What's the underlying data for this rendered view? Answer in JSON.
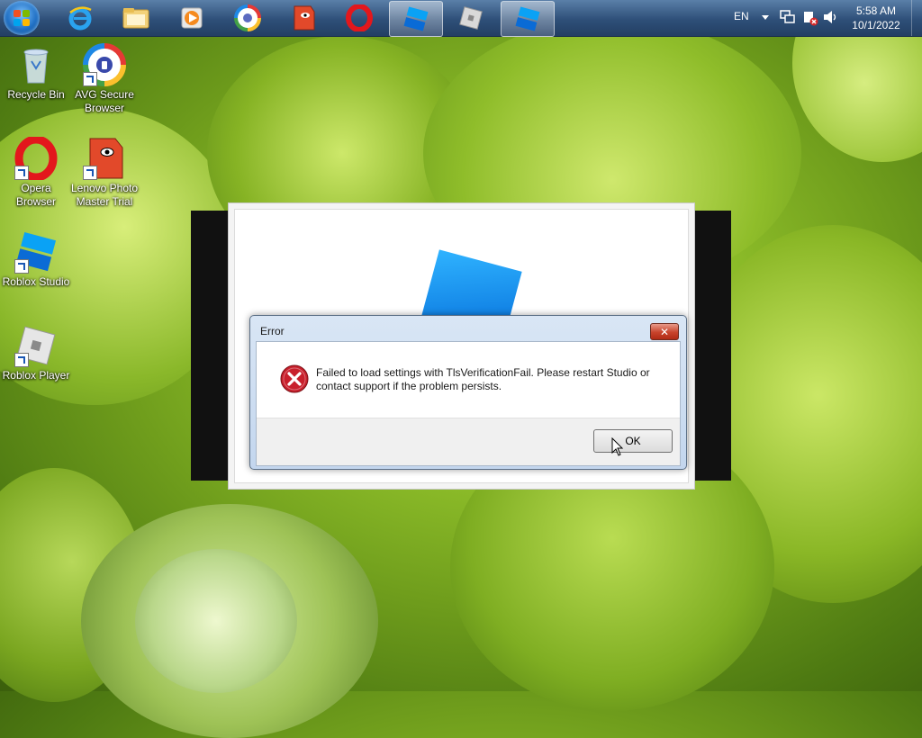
{
  "desktop": {
    "icons": [
      {
        "label": "Recycle Bin"
      },
      {
        "label": "AVG Secure Browser"
      },
      {
        "label": "Opera Browser"
      },
      {
        "label": "Lenovo Photo Master Trial"
      },
      {
        "label": "Roblox Studio"
      },
      {
        "label": "Roblox Player"
      }
    ]
  },
  "taskbar": {
    "language": "EN",
    "time": "5:58 AM",
    "date": "10/1/2022"
  },
  "dialog": {
    "title": "Error",
    "close_label": "✕",
    "message": "Failed to load settings with TlsVerificationFail. Please restart Studio or contact support if the problem persists.",
    "ok_label": "OK"
  },
  "colors": {
    "accent_blue": "#1f6fc4",
    "error_red": "#c8202c",
    "roblox_blue": "#0a84ff"
  }
}
